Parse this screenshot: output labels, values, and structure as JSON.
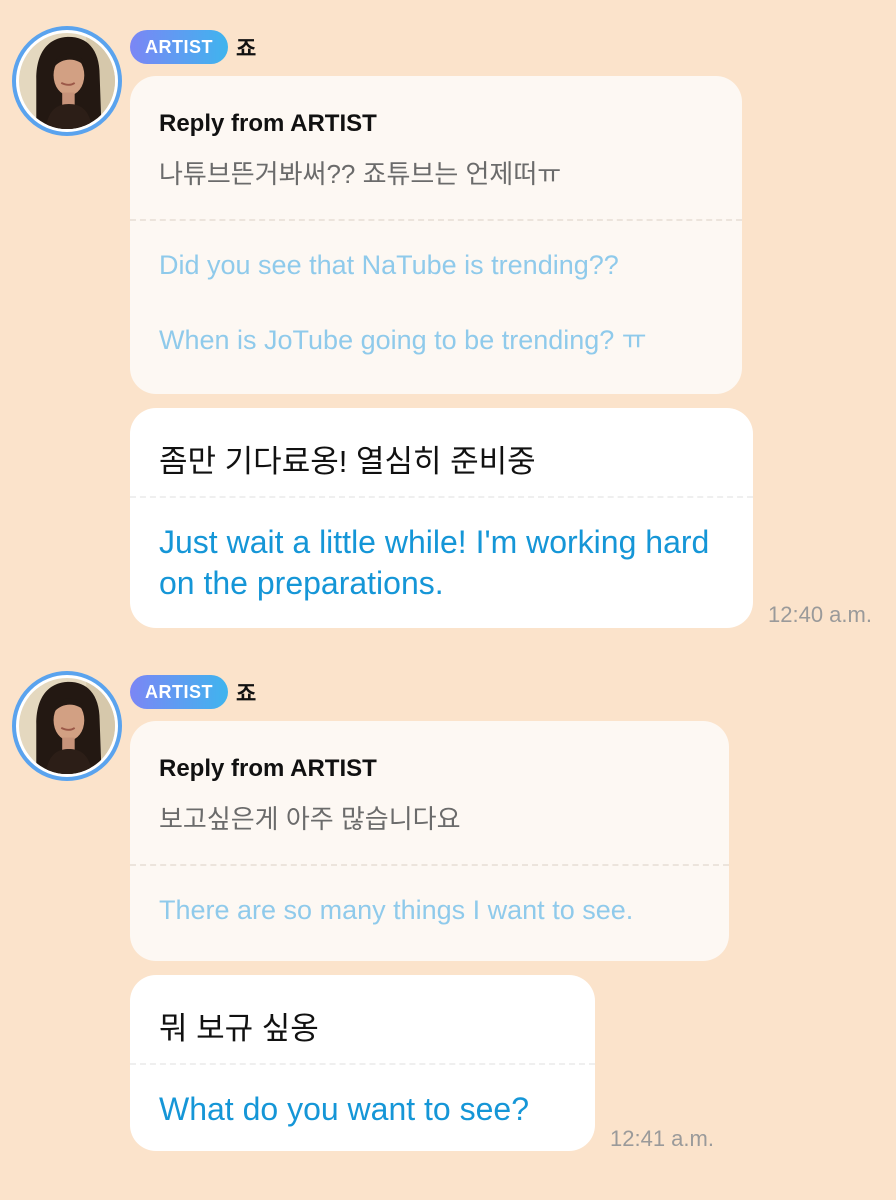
{
  "conversation": [
    {
      "badge": "ARTIST",
      "artist_name": "죠",
      "reply": {
        "label": "Reply from ARTIST",
        "original": "나튜브뜬거봐써?? 죠튜브는 언제떠ㅠ",
        "translation_line1": "Did you see that NaTube is trending??",
        "translation_line2": "When is JoTube going to be trending? ㅠ"
      },
      "message": {
        "original": "좀만 기다료옹! 열심히 준비중",
        "translation": "Just wait a little while! I'm working hard on the preparations."
      },
      "time": "12:40 a.m."
    },
    {
      "badge": "ARTIST",
      "artist_name": "죠",
      "reply": {
        "label": "Reply from ARTIST",
        "original": "보고싶은게 아주 많습니다요",
        "translation_line1": "There are so many things I want to see."
      },
      "message": {
        "original": "뭐 보규 싶옹",
        "translation": "What do you want to see?"
      },
      "time": "12:41 a.m."
    }
  ],
  "colors": {
    "background": "#fbe3cb",
    "badge_gradient_start": "#7b86f5",
    "badge_gradient_end": "#3fb4ee",
    "avatar_ring": "#5aa3ee",
    "translation_strong": "#1596d7",
    "translation_faded": "#8fcaeb"
  }
}
